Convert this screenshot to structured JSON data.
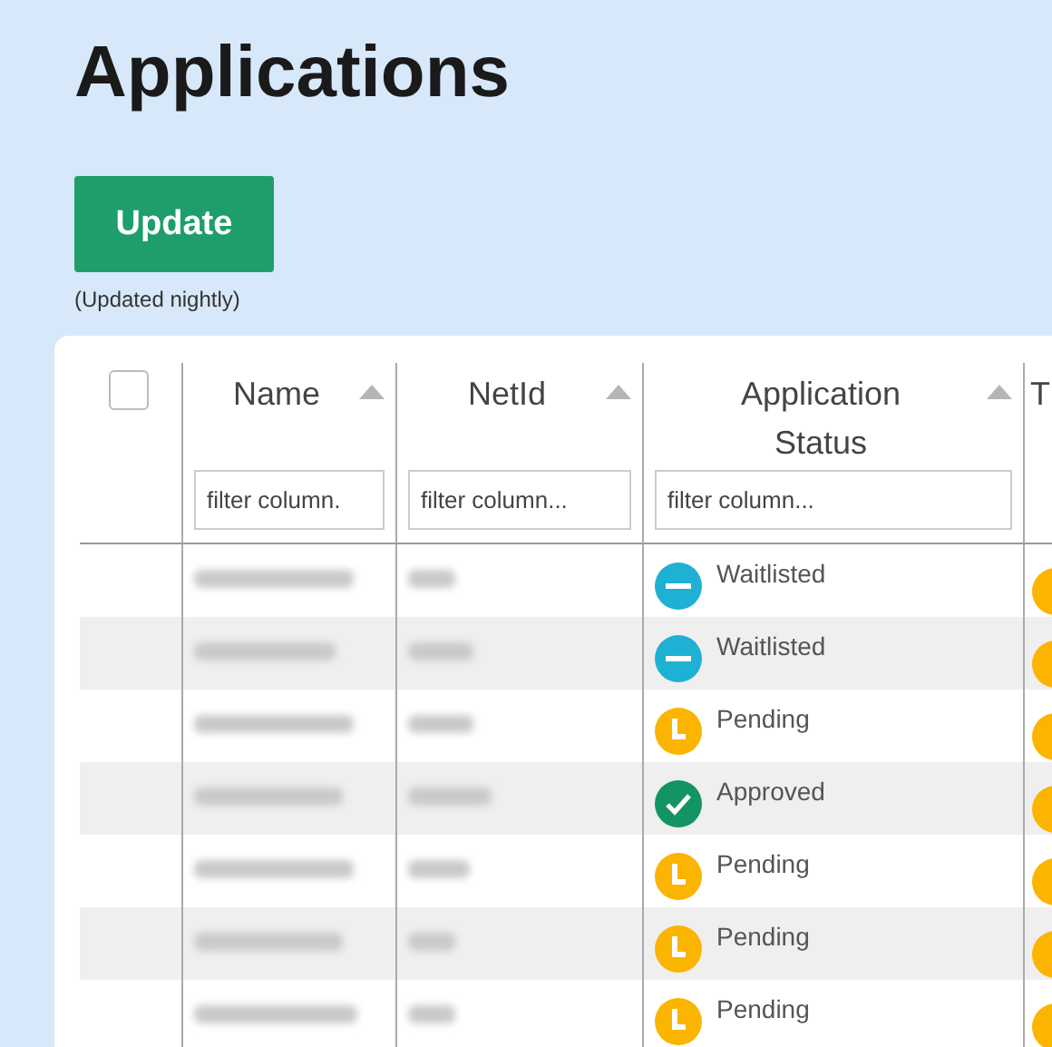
{
  "title": "Applications",
  "update_button": "Update",
  "update_note": "(Updated nightly)",
  "table": {
    "select_all": {
      "checked": false
    },
    "columns": [
      {
        "label": "Name",
        "placeholder": "filter column.",
        "sortable": true
      },
      {
        "label": "NetId",
        "placeholder": "filter column...",
        "sortable": true
      },
      {
        "label": "Application Status",
        "placeholder": "filter column...",
        "sortable": true
      },
      {
        "label": "T"
      }
    ],
    "rows": [
      {
        "status": {
          "kind": "waitlisted",
          "label": "Waitlisted"
        },
        "column_4": {
          "kind": "pending"
        }
      },
      {
        "status": {
          "kind": "waitlisted",
          "label": "Waitlisted"
        },
        "column_4": {
          "kind": "pending"
        }
      },
      {
        "status": {
          "kind": "pending",
          "label": "Pending"
        },
        "column_4": {
          "kind": "pending"
        }
      },
      {
        "status": {
          "kind": "approved",
          "label": "Approved"
        },
        "column_4": {
          "kind": "pending"
        }
      },
      {
        "status": {
          "kind": "pending",
          "label": "Pending"
        },
        "column_4": {
          "kind": "pending"
        }
      },
      {
        "status": {
          "kind": "pending",
          "label": "Pending"
        },
        "column_4": {
          "kind": "pending"
        }
      },
      {
        "status": {
          "kind": "pending",
          "label": "Pending"
        },
        "column_4": {
          "kind": "pending"
        }
      }
    ]
  }
}
